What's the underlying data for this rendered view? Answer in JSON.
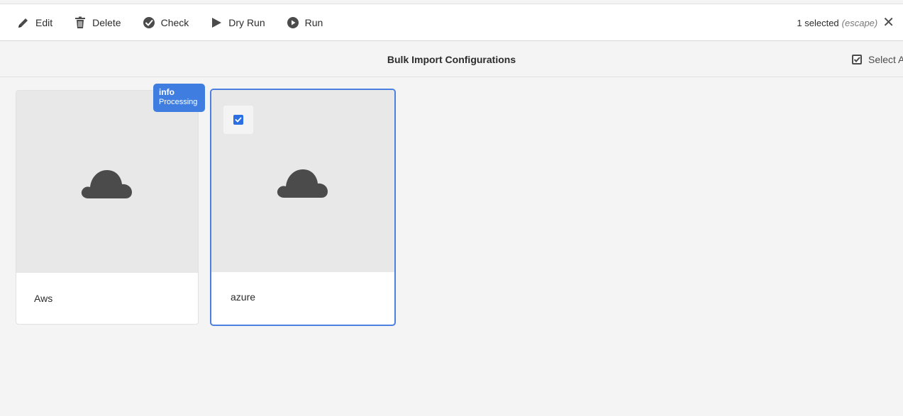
{
  "actionbar": {
    "actions": [
      {
        "label": "Edit",
        "icon": "pencil-icon"
      },
      {
        "label": "Delete",
        "icon": "trash-icon"
      },
      {
        "label": "Check",
        "icon": "check-circle-icon"
      },
      {
        "label": "Dry Run",
        "icon": "play-icon"
      },
      {
        "label": "Run",
        "icon": "play-circle-icon"
      }
    ],
    "selection": {
      "count_text": "1 selected",
      "escape_hint": "(escape)",
      "close_icon": "close-icon"
    }
  },
  "titlebar": {
    "title": "Bulk Import Configurations",
    "select_all_label": "Select All",
    "select_all_icon": "select-all-checkbox-icon"
  },
  "cards": [
    {
      "name": "Aws",
      "icon": "cloud-icon",
      "selected": false,
      "badge": {
        "title": "info",
        "status": "Processing"
      }
    },
    {
      "name": "azure",
      "icon": "cloud-icon",
      "selected": true
    }
  ],
  "colors": {
    "accent": "#3f7ee0",
    "selection_border": "#4b7fe0",
    "checkbox": "#2c6fe3",
    "thumb_bg": "#e8e8e8",
    "icon_dark": "#4b4b4b"
  }
}
